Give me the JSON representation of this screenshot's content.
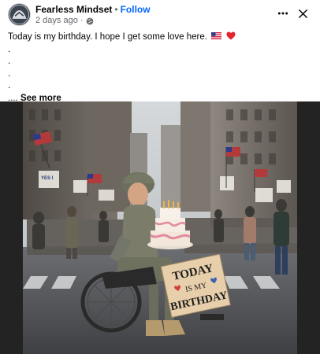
{
  "post": {
    "author_name": "Fearless Mindset",
    "separator": "•",
    "follow_label": "Follow",
    "timestamp": "2 days ago",
    "meta_separator": "·",
    "privacy_icon": "globe-icon",
    "more_icon": "more-dots-icon",
    "close_icon": "close-icon",
    "text_lines": [
      "Today is my birthday. I hope I get some love here.",
      ".",
      ".",
      ".",
      "."
    ],
    "ellipsis": "....",
    "see_more_label": "See more",
    "emojis": [
      "us-flag-icon",
      "red-heart-icon"
    ]
  },
  "image": {
    "sign_text": [
      "TODAY",
      "IS MY",
      "BIRTHDAY"
    ],
    "crowd_sign_text": "YES I SEE YOU"
  },
  "colors": {
    "link": "#0866ff",
    "secondary_text": "#65676b",
    "media_background": "#232323",
    "heart": "#e4252b"
  }
}
